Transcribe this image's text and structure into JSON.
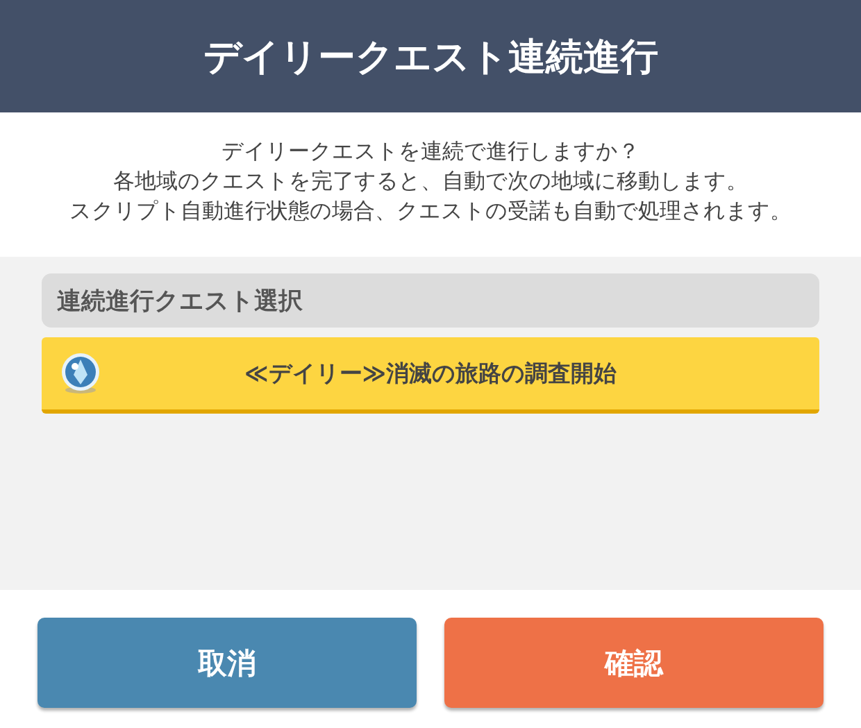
{
  "header": {
    "title": "デイリークエスト連続進行"
  },
  "message": [
    "デイリークエストを連続で進行しますか？",
    "各地域のクエストを完了すると、自動で次の地域に移動します。",
    "スクリプト自動進行状態の場合、クエストの受諾も自動で処理されます。"
  ],
  "quest_section": {
    "title": "連続進行クエスト選択",
    "quests": [
      {
        "label": "≪デイリー≫消滅の旅路の調査開始"
      }
    ]
  },
  "buttons": [
    {
      "label": "取消",
      "kind": "cancel"
    },
    {
      "label": "確認",
      "kind": "confirm"
    }
  ]
}
